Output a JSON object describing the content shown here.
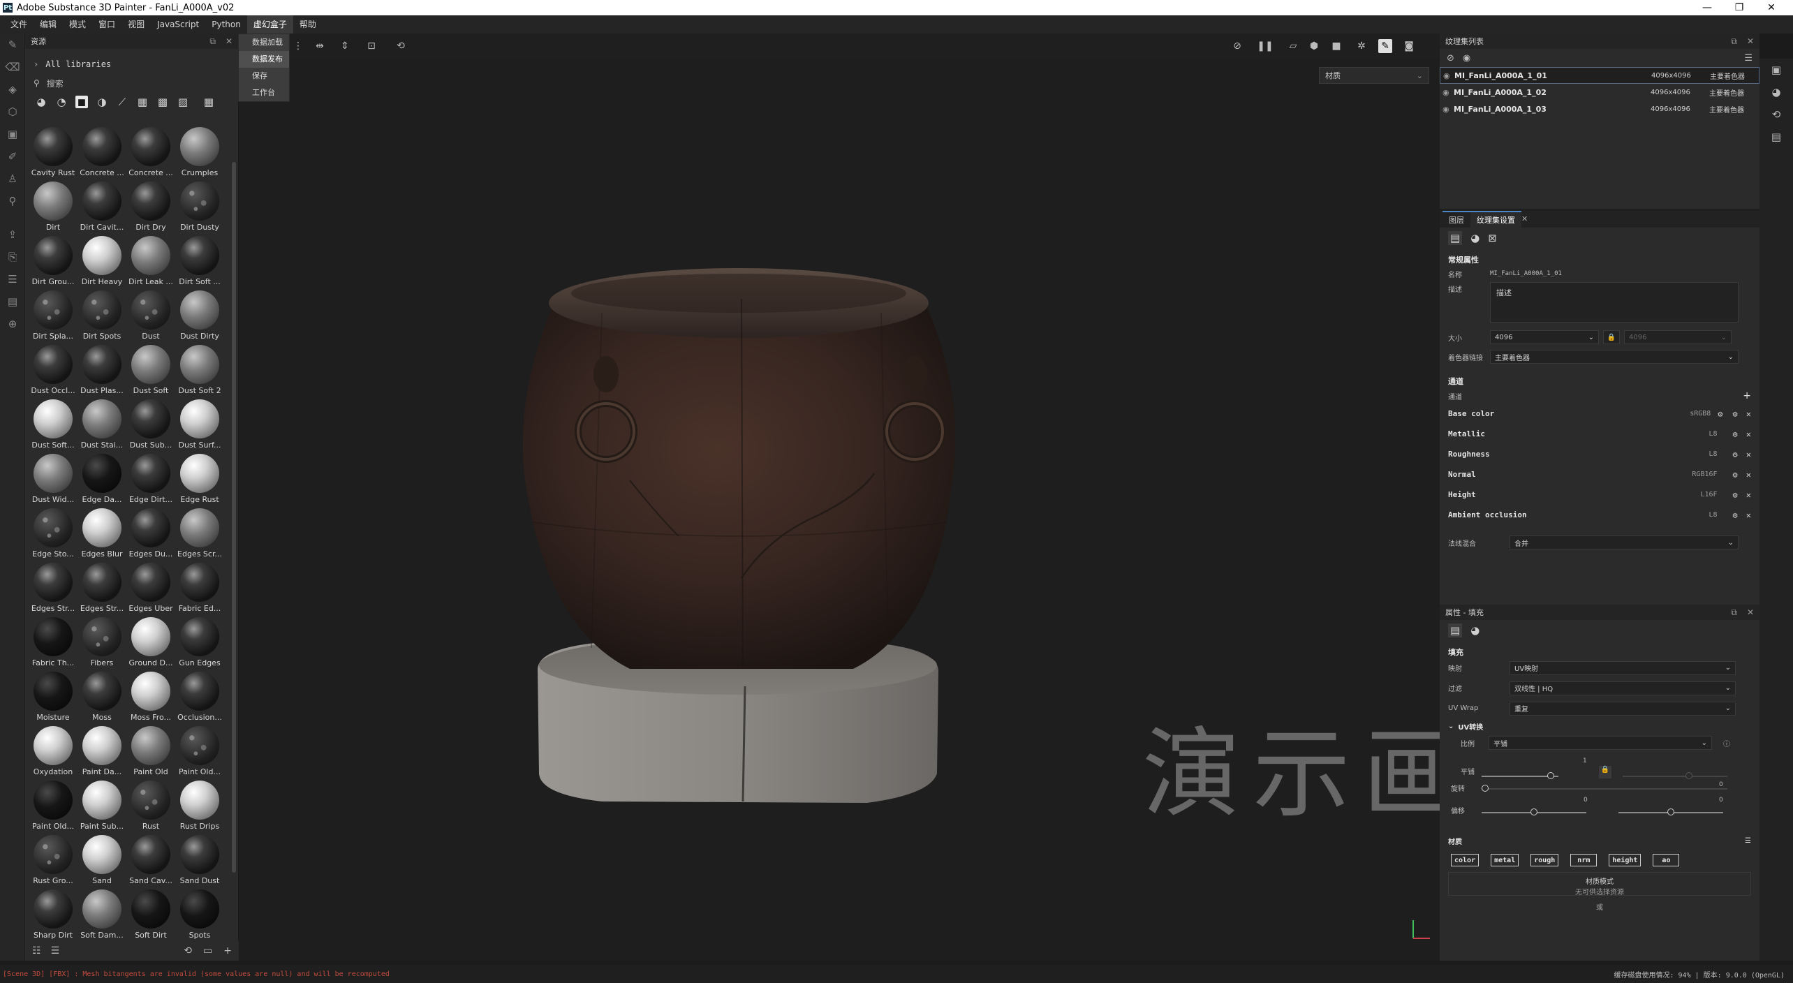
{
  "window": {
    "title": "Adobe Substance 3D Painter - FanLi_A000A_v02",
    "app_icon": "Pt",
    "minimize": "—",
    "maximize": "❐",
    "close": "✕"
  },
  "menu": [
    "文件",
    "编辑",
    "模式",
    "窗口",
    "视图",
    "JavaScript",
    "Python",
    "虚幻盒子",
    "帮助"
  ],
  "menu_active_index": 7,
  "dropdown": {
    "items": [
      "数据加载",
      "数据发布",
      "保存",
      "工作台"
    ],
    "highlighted_index": 1
  },
  "assets": {
    "title": "资源",
    "library": "All libraries",
    "search_placeholder": "搜索",
    "items": [
      {
        "label": "Cavity Rust",
        "tone": "dark"
      },
      {
        "label": "Concrete ...",
        "tone": "dark"
      },
      {
        "label": "Concrete ...",
        "tone": "dark"
      },
      {
        "label": "Crumples",
        "tone": "grey"
      },
      {
        "label": "Dirt",
        "tone": "grey"
      },
      {
        "label": "Dirt Cavit...",
        "tone": "dark"
      },
      {
        "label": "Dirt Dry",
        "tone": "dark"
      },
      {
        "label": "Dirt Dusty",
        "tone": "speck"
      },
      {
        "label": "Dirt Grou...",
        "tone": "dark"
      },
      {
        "label": "Dirt Heavy",
        "tone": "light"
      },
      {
        "label": "Dirt Leak ...",
        "tone": "grey"
      },
      {
        "label": "Dirt Soft ...",
        "tone": "dark"
      },
      {
        "label": "Dirt Spla...",
        "tone": "speck"
      },
      {
        "label": "Dirt Spots",
        "tone": "speck"
      },
      {
        "label": "Dust",
        "tone": "speck"
      },
      {
        "label": "Dust Dirty",
        "tone": "grey"
      },
      {
        "label": "Dust Occl...",
        "tone": "dark"
      },
      {
        "label": "Dust Plas...",
        "tone": "dark"
      },
      {
        "label": "Dust Soft",
        "tone": "grey"
      },
      {
        "label": "Dust Soft 2",
        "tone": "grey"
      },
      {
        "label": "Dust Soft...",
        "tone": "light"
      },
      {
        "label": "Dust Stai...",
        "tone": "grey"
      },
      {
        "label": "Dust Sub...",
        "tone": "dark"
      },
      {
        "label": "Dust Surf...",
        "tone": "light"
      },
      {
        "label": "Dust Wid...",
        "tone": "grey"
      },
      {
        "label": "Edge Da...",
        "tone": "black"
      },
      {
        "label": "Edge Dirt...",
        "tone": "dark"
      },
      {
        "label": "Edge Rust",
        "tone": "light"
      },
      {
        "label": "Edge Sto...",
        "tone": "speck"
      },
      {
        "label": "Edges Blur",
        "tone": "light"
      },
      {
        "label": "Edges Du...",
        "tone": "dark"
      },
      {
        "label": "Edges Scr...",
        "tone": "grey"
      },
      {
        "label": "Edges Str...",
        "tone": "dark"
      },
      {
        "label": "Edges Str...",
        "tone": "dark"
      },
      {
        "label": "Edges Uber",
        "tone": "dark"
      },
      {
        "label": "Fabric Ed...",
        "tone": "dark"
      },
      {
        "label": "Fabric Th...",
        "tone": "black"
      },
      {
        "label": "Fibers",
        "tone": "speck"
      },
      {
        "label": "Ground D...",
        "tone": "light"
      },
      {
        "label": "Gun Edges",
        "tone": "dark"
      },
      {
        "label": "Moisture",
        "tone": "black"
      },
      {
        "label": "Moss",
        "tone": "dark"
      },
      {
        "label": "Moss Fro...",
        "tone": "light"
      },
      {
        "label": "Occlusion...",
        "tone": "dark"
      },
      {
        "label": "Oxydation",
        "tone": "light"
      },
      {
        "label": "Paint Da...",
        "tone": "light"
      },
      {
        "label": "Paint Old",
        "tone": "grey"
      },
      {
        "label": "Paint Old...",
        "tone": "speck"
      },
      {
        "label": "Paint Old...",
        "tone": "black"
      },
      {
        "label": "Paint Sub...",
        "tone": "light"
      },
      {
        "label": "Rust",
        "tone": "speck"
      },
      {
        "label": "Rust Drips",
        "tone": "light"
      },
      {
        "label": "Rust Gro...",
        "tone": "speck"
      },
      {
        "label": "Sand",
        "tone": "light"
      },
      {
        "label": "Sand Cav...",
        "tone": "dark"
      },
      {
        "label": "Sand Dust",
        "tone": "dark"
      },
      {
        "label": "Sharp Dirt",
        "tone": "dark"
      },
      {
        "label": "Soft Dam...",
        "tone": "grey"
      },
      {
        "label": "Soft Dirt",
        "tone": "black"
      },
      {
        "label": "Spots",
        "tone": "black"
      }
    ]
  },
  "viewport": {
    "display_mode": "材质",
    "watermark": "演示画面"
  },
  "texture_sets": {
    "title": "纹理集列表",
    "rows": [
      {
        "name": "MI_FanLi_A000A_1_01",
        "resolution": "4096x4096",
        "shader": "主要着色器"
      },
      {
        "name": "MI_FanLi_A000A_1_02",
        "resolution": "4096x4096",
        "shader": "主要着色器"
      },
      {
        "name": "MI_FanLi_A000A_1_03",
        "resolution": "4096x4096",
        "shader": "主要着色器"
      }
    ]
  },
  "settings": {
    "tab_layers": "图层",
    "tab_settings": "纹理集设置",
    "section_general": "常规属性",
    "name_label": "名称",
    "name_value": "MI_FanLi_A000A_1_01",
    "desc_label": "描述",
    "desc_value": "描述",
    "size_label": "大小",
    "size_value": "4096",
    "size_value2": "4096",
    "shader_label": "着色器链接",
    "shader_value": "主要着色器",
    "section_channels": "通道",
    "channels_label": "通道",
    "channels": [
      {
        "name": "Base color",
        "format": "sRGB8"
      },
      {
        "name": "Metallic",
        "format": "L8"
      },
      {
        "name": "Roughness",
        "format": "L8"
      },
      {
        "name": "Normal",
        "format": "RGB16F"
      },
      {
        "name": "Height",
        "format": "L16F"
      },
      {
        "name": "Ambient occlusion",
        "format": "L8"
      }
    ],
    "blend_label": "法线混合",
    "blend_value": "合并"
  },
  "fill": {
    "title": "属性 - 填充",
    "section": "填充",
    "mapping_label": "映射",
    "mapping_value": "UV映射",
    "filter_label": "过滤",
    "filter_value": "双线性 | HQ",
    "wrap_label": "UV Wrap",
    "wrap_value": "重复",
    "uv_section": "UV转换",
    "ratio_label": "比例",
    "ratio_value": "平铺",
    "tile_label": "平铺",
    "tile_value": "1",
    "rotate_label": "旋转",
    "rotate_value": "0",
    "offset_label": "偏移",
    "offset_value_a": "0",
    "offset_value_b": "0",
    "material_section": "材质",
    "chips": [
      "color",
      "metal",
      "rough",
      "nrm",
      "height",
      "ao"
    ],
    "material_mode": "材质模式",
    "material_mode_value": "无可供选择资源",
    "or_label": "或"
  },
  "status": {
    "error": "[Scene 3D] [FBX] : Mesh bitangents are invalid (some values are null) and will be recomputed",
    "info": "缓存磁盘使用情况:  94%  | 版本: 9.0.0 (OpenGL)"
  },
  "colors": {
    "accent": "#4a86c8",
    "error": "#c24b3d",
    "rust_dark": "#3a2620",
    "stone": "#8d8b87"
  }
}
